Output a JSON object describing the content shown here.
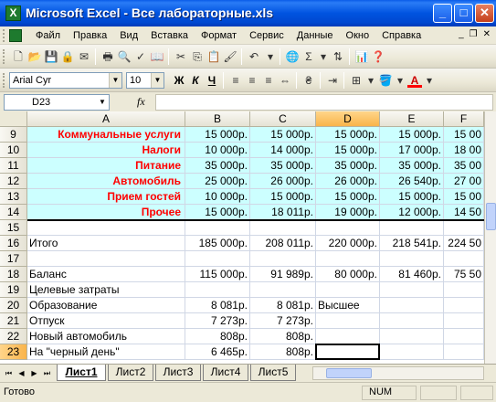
{
  "window": {
    "title": "Microsoft Excel - Все лабораторные.xls",
    "app_icon": "X"
  },
  "menu": {
    "items": [
      "Файл",
      "Правка",
      "Вид",
      "Вставка",
      "Формат",
      "Сервис",
      "Данные",
      "Окно",
      "Справка"
    ],
    "right_close": "✕"
  },
  "toolbar": {
    "font_name": "Arial Cyr",
    "font_size": "10",
    "bold": "Ж",
    "italic": "К",
    "underline": "Ч"
  },
  "formula_bar": {
    "name_box": "D23",
    "fx": "fx",
    "content": ""
  },
  "columns": [
    "A",
    "B",
    "C",
    "D",
    "E",
    "F"
  ],
  "selected_column": "D",
  "rows": [
    {
      "n": "9",
      "a": "Коммунальные услуги",
      "b": "15 000р.",
      "c": "15 000р.",
      "d": "15 000р.",
      "e": "15 000р.",
      "f": "15 00",
      "style": "cy"
    },
    {
      "n": "10",
      "a": "Налоги",
      "b": "10 000р.",
      "c": "14 000р.",
      "d": "15 000р.",
      "e": "17 000р.",
      "f": "18 00",
      "style": "cy"
    },
    {
      "n": "11",
      "a": "Питание",
      "b": "35 000р.",
      "c": "35 000р.",
      "d": "35 000р.",
      "e": "35 000р.",
      "f": "35 00",
      "style": "cy"
    },
    {
      "n": "12",
      "a": "Автомобиль",
      "b": "25 000р.",
      "c": "26 000р.",
      "d": "26 000р.",
      "e": "26 540р.",
      "f": "27 00",
      "style": "cy"
    },
    {
      "n": "13",
      "a": "Прием гостей",
      "b": "10 000р.",
      "c": "15 000р.",
      "d": "15 000р.",
      "e": "15 000р.",
      "f": "15 00",
      "style": "cy"
    },
    {
      "n": "14",
      "a": "Прочее",
      "b": "15 000р.",
      "c": "18 011р.",
      "d": "19 000р.",
      "e": "12 000р.",
      "f": "14 50",
      "style": "cy"
    },
    {
      "n": "15",
      "a": "",
      "b": "",
      "c": "",
      "d": "",
      "e": "",
      "f": "",
      "style": "plain"
    },
    {
      "n": "16",
      "a": "Итого",
      "b": "185 000р.",
      "c": "208 011р.",
      "d": "220 000р.",
      "e": "218 541р.",
      "f": "224 50",
      "style": "plain"
    },
    {
      "n": "17",
      "a": "",
      "b": "",
      "c": "",
      "d": "",
      "e": "",
      "f": "",
      "style": "plain"
    },
    {
      "n": "18",
      "a": "Баланс",
      "b": "115 000р.",
      "c": "91 989р.",
      "d": "80 000р.",
      "e": "81 460р.",
      "f": "75 50",
      "style": "plain"
    },
    {
      "n": "19",
      "a": "Целевые затраты",
      "b": "",
      "c": "",
      "d": "",
      "e": "",
      "f": "",
      "style": "plain"
    },
    {
      "n": "20",
      "a": "Образование",
      "b": "8 081р.",
      "c": "8 081р.",
      "d": "Высшее",
      "e": "",
      "f": "",
      "style": "plain"
    },
    {
      "n": "21",
      "a": "Отпуск",
      "b": "7 273р.",
      "c": "7 273р.",
      "d": "",
      "e": "",
      "f": "",
      "style": "plain"
    },
    {
      "n": "22",
      "a": "Новый автомобиль",
      "b": "808р.",
      "c": "808р.",
      "d": "",
      "e": "",
      "f": "",
      "style": "plain"
    },
    {
      "n": "23",
      "a": "На \"черный день\"",
      "b": "6 465р.",
      "c": "808р.",
      "d": "",
      "e": "",
      "f": "",
      "style": "plain"
    }
  ],
  "selected_row": "23",
  "sheets": [
    "Лист1",
    "Лист2",
    "Лист3",
    "Лист4",
    "Лист5"
  ],
  "active_sheet": "Лист1",
  "status": {
    "text": "Готово",
    "num": "NUM"
  }
}
